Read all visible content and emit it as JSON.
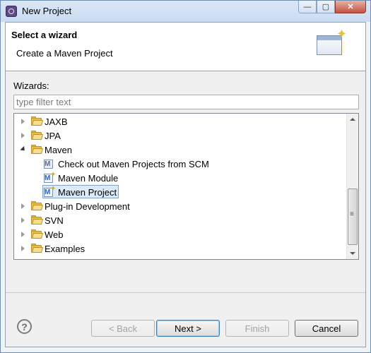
{
  "window": {
    "title": "New Project",
    "controls": {
      "minimize": "—",
      "maximize": "▢",
      "close": "✕"
    }
  },
  "header": {
    "title": "Select a wizard",
    "message": "Create a Maven Project"
  },
  "wizards_label": "Wizards:",
  "filter": {
    "value": "",
    "placeholder": "type filter text"
  },
  "tree": {
    "items": [
      {
        "label": "JAXB",
        "expanded": false
      },
      {
        "label": "JPA",
        "expanded": false
      },
      {
        "label": "Maven",
        "expanded": true
      },
      {
        "label": "Check out Maven Projects from SCM"
      },
      {
        "label": "Maven Module"
      },
      {
        "label": "Maven Project",
        "selected": true
      },
      {
        "label": "Plug-in Development",
        "expanded": false
      },
      {
        "label": "SVN",
        "expanded": false
      },
      {
        "label": "Web",
        "expanded": false
      },
      {
        "label": "Examples",
        "expanded": false
      }
    ]
  },
  "buttons": {
    "back": "< Back",
    "next": "Next >",
    "finish": "Finish",
    "cancel": "Cancel",
    "help": "?"
  }
}
